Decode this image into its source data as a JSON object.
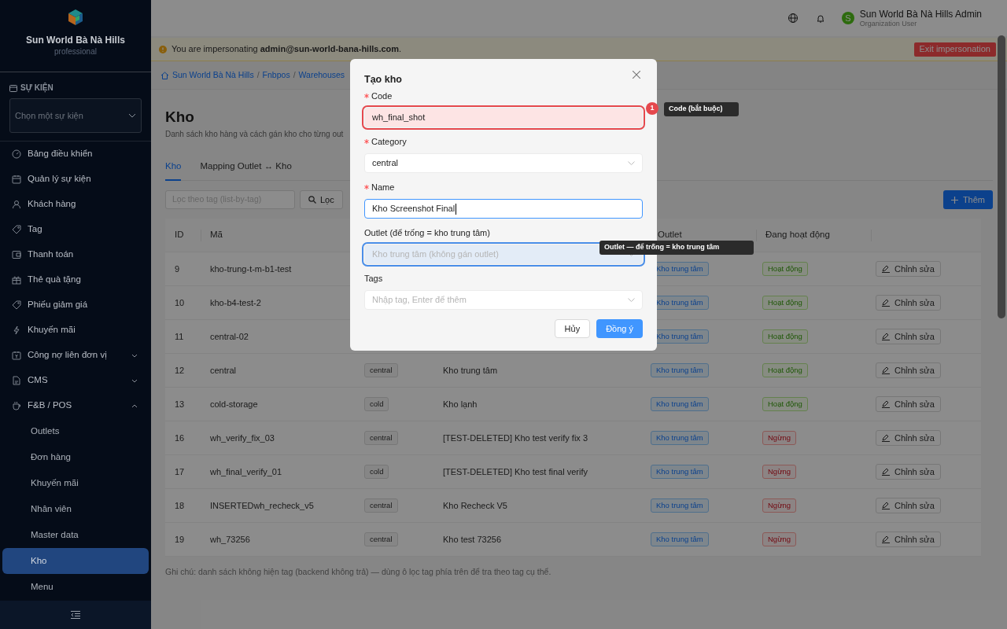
{
  "sidebar": {
    "brand": {
      "title": "Sun World Bà Nà Hills",
      "subtitle": "professional"
    },
    "event_section": {
      "label": "SỰ KIỆN",
      "placeholder": "Chọn một sự kiện"
    },
    "items": [
      {
        "label": "Bảng điều khiển",
        "selected": false
      },
      {
        "label": "Quản lý sự kiện",
        "selected": false
      },
      {
        "label": "Khách hàng",
        "selected": false
      },
      {
        "label": "Tag",
        "selected": false
      },
      {
        "label": "Thanh toán",
        "selected": false
      },
      {
        "label": "Thẻ quà tặng",
        "selected": false
      },
      {
        "label": "Phiếu giảm giá",
        "selected": false
      },
      {
        "label": "Khuyến mãi",
        "selected": false
      },
      {
        "label": "Công nợ liên đơn vị",
        "selected": false,
        "expanded": false
      },
      {
        "label": "CMS",
        "selected": false,
        "expanded": false
      },
      {
        "label": "F&B / POS",
        "selected": false,
        "expanded": true,
        "children": [
          {
            "label": "Outlets",
            "selected": false
          },
          {
            "label": "Đơn hàng",
            "selected": false
          },
          {
            "label": "Khuyến mãi",
            "selected": false
          },
          {
            "label": "Nhân viên",
            "selected": false
          },
          {
            "label": "Master data",
            "selected": false
          },
          {
            "label": "Kho",
            "selected": true
          },
          {
            "label": "Menu",
            "selected": false
          }
        ]
      }
    ]
  },
  "header": {
    "user": {
      "initial": "S",
      "name": "Sun World Bà Nà Hills Admin",
      "role": "Organization User"
    }
  },
  "banner": {
    "text": "You are impersonating **admin@sun-world-bana-hills.com**.",
    "button": "Exit impersonation"
  },
  "breadcrumb": {
    "separator": "/",
    "items": [
      "Sun World Bà Nà Hills",
      "Fnbpos",
      "Warehouses"
    ]
  },
  "page": {
    "title": "Kho",
    "subtitle": "Danh sách kho hàng và cách gán kho cho từng out"
  },
  "tabs": [
    {
      "label": "Kho",
      "selected": true
    },
    {
      "label": "Mapping Outlet ↔ Kho",
      "selected": false
    }
  ],
  "filter": {
    "placeholder": "Lọc theo tag (list-by-tag)",
    "button": "Lọc"
  },
  "add_button": "Thêm",
  "table": {
    "columns": [
      "ID",
      "Mã",
      "Outlet",
      "Đang hoạt động"
    ],
    "rows": [
      {
        "id": "9",
        "code": "kho-trung-t-m-b1-test",
        "outlet": "Kho trung tâm",
        "active": true,
        "status": "Hoạt động",
        "action": "Chỉnh sửa"
      },
      {
        "id": "10",
        "code": "kho-b4-test-2",
        "outlet": "Kho trung tâm",
        "active": true,
        "status": "Hoạt động",
        "action": "Chỉnh sửa"
      },
      {
        "id": "11",
        "code": "central-02",
        "outlet": "Kho trung tâm",
        "active": true,
        "status": "Hoạt động",
        "action": "Chỉnh sửa"
      },
      {
        "id": "12",
        "code": "central",
        "category": "central",
        "name": "Kho trung tâm",
        "outlet": "Kho trung tâm",
        "active": true,
        "status": "Hoạt động",
        "action": "Chỉnh sửa"
      },
      {
        "id": "13",
        "code": "cold-storage",
        "category": "cold",
        "name": "Kho lạnh",
        "outlet": "Kho trung tâm",
        "active": true,
        "status": "Hoạt động",
        "action": "Chỉnh sửa"
      },
      {
        "id": "16",
        "code": "wh_verify_fix_03",
        "category": "central",
        "name": "[TEST-DELETED] Kho test verify fix 3",
        "outlet": "Kho trung tâm",
        "active": false,
        "status": "Ngừng",
        "action": "Chỉnh sửa"
      },
      {
        "id": "17",
        "code": "wh_final_verify_01",
        "category": "cold",
        "name": "[TEST-DELETED] Kho test final verify",
        "outlet": "Kho trung tâm",
        "active": false,
        "status": "Ngừng",
        "action": "Chỉnh sửa"
      },
      {
        "id": "18",
        "code": "INSERTEDwh_recheck_v5",
        "category": "central",
        "name": "Kho Recheck V5",
        "outlet": "Kho trung tâm",
        "active": false,
        "status": "Ngừng",
        "action": "Chỉnh sửa"
      },
      {
        "id": "19",
        "code": "wh_73256",
        "category": "central",
        "name": "Kho test 73256",
        "outlet": "Kho trung tâm",
        "active": false,
        "status": "Ngừng",
        "action": "Chỉnh sửa"
      }
    ]
  },
  "note": "Ghi chú: danh sách không hiện tag (backend không trả) — dùng ô lọc tag phía trên để tra theo tag cụ thể.",
  "dialog": {
    "title": "Tạo kho",
    "fields": [
      {
        "kind": "input",
        "label": "Code",
        "required": true,
        "value": "wh_final_shot",
        "error": true,
        "badge": "1",
        "tooltip": "Code (bắt buộc)"
      },
      {
        "kind": "select",
        "label": "Category",
        "required": true,
        "value": "central"
      },
      {
        "kind": "input",
        "label": "Name",
        "required": true,
        "value": "Kho Screenshot Final",
        "focused": true
      },
      {
        "kind": "select",
        "label": "Outlet (để trống = kho trung tâm)",
        "placeholder": "Kho trung tâm (không gán outlet)",
        "highlighted": true,
        "tooltip": "Outlet — để trống = kho trung tâm"
      },
      {
        "kind": "select",
        "label": "Tags",
        "placeholder": "Nhập tag, Enter để thêm"
      }
    ],
    "cancel": "Hủy",
    "ok": "Đồng ý"
  }
}
